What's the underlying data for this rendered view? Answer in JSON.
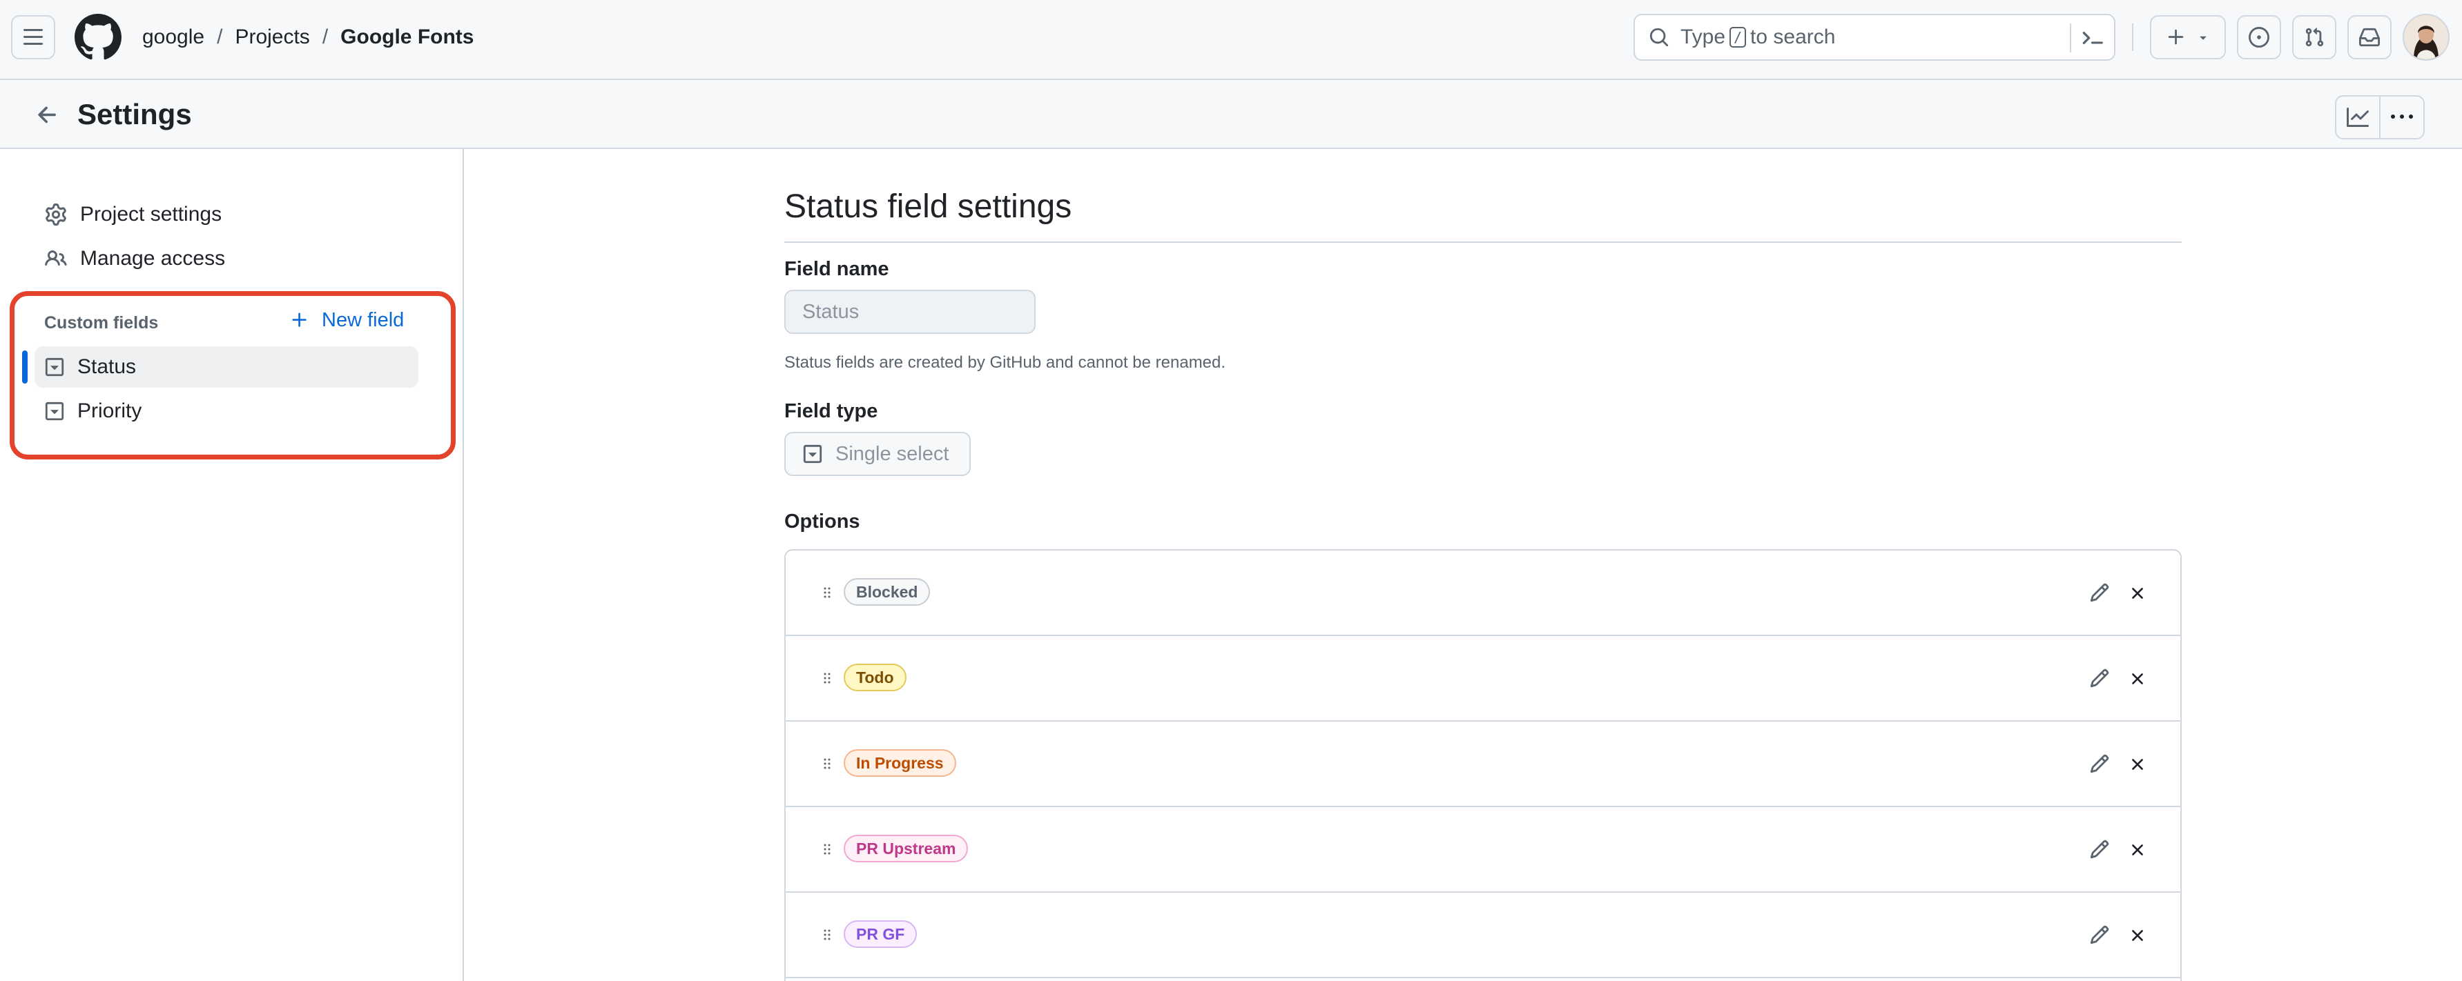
{
  "header": {
    "breadcrumbs": [
      "google",
      "Projects",
      "Google Fonts"
    ],
    "separator": "/",
    "search": {
      "prefix": "Type",
      "key": "/",
      "suffix": "to search"
    }
  },
  "subheader": {
    "title": "Settings"
  },
  "sidebar": {
    "items": [
      {
        "label": "Project settings",
        "icon": "gear-icon"
      },
      {
        "label": "Manage access",
        "icon": "people-icon"
      }
    ],
    "custom_fields_label": "Custom fields",
    "new_field_label": "New field",
    "fields": [
      {
        "label": "Status",
        "icon": "single-select-icon",
        "active": true
      },
      {
        "label": "Priority",
        "icon": "single-select-icon",
        "active": false
      }
    ]
  },
  "main": {
    "title": "Status field settings",
    "field_name_label": "Field name",
    "field_name_value": "Status",
    "field_name_hint": "Status fields are created by GitHub and cannot be renamed.",
    "field_type_label": "Field type",
    "field_type_value": "Single select",
    "options_label": "Options",
    "options": [
      {
        "label": "Blocked",
        "color": "#59636e"
      },
      {
        "label": "Todo",
        "color": "#7d4e00"
      },
      {
        "label": "In Progress",
        "color": "#bc4c00"
      },
      {
        "label": "PR Upstream",
        "color": "#bf3989"
      },
      {
        "label": "PR GF",
        "color": "#8250df"
      }
    ]
  },
  "colors": {
    "accent": "#0969da",
    "highlight": "#e2432a"
  }
}
